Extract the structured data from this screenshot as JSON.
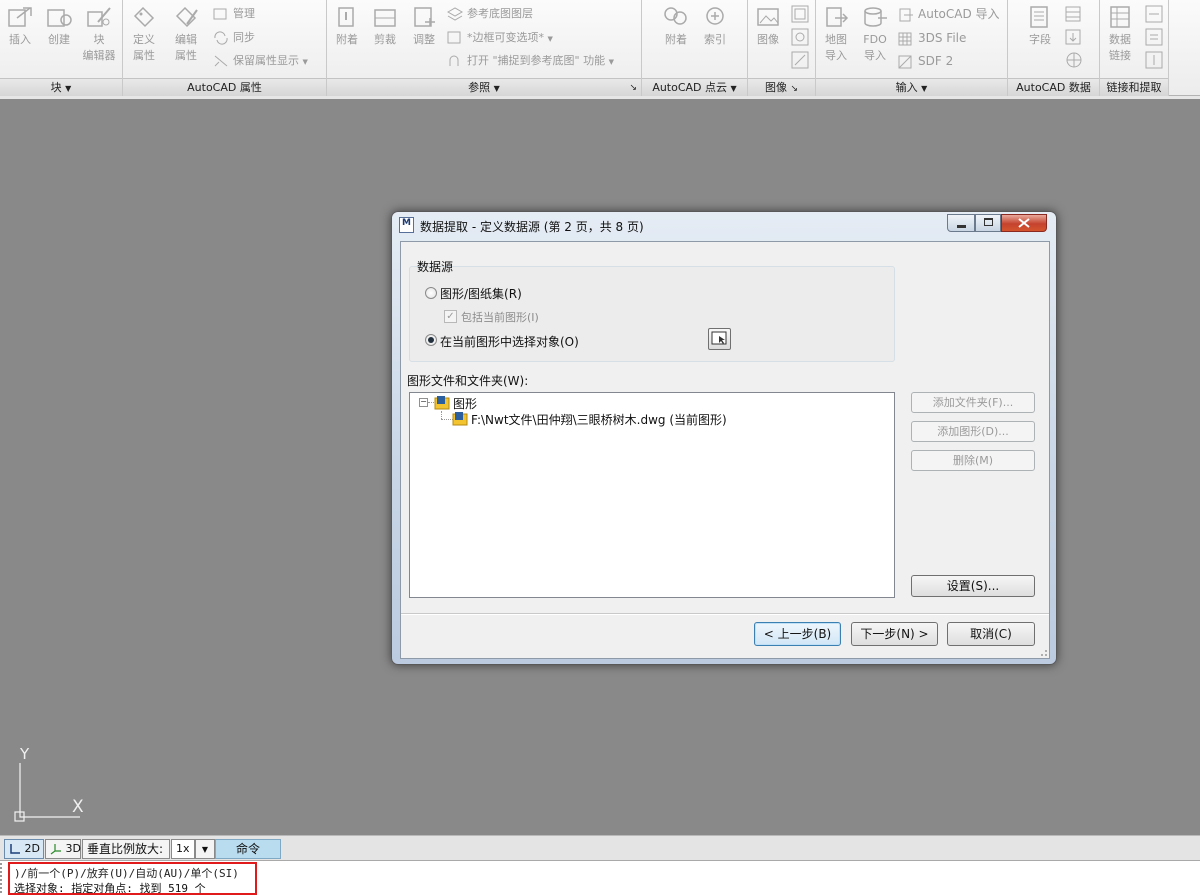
{
  "ribbon": {
    "panels": {
      "block": {
        "title": "块",
        "insert": "插入",
        "create": "创建",
        "block_editor": [
          "块",
          "编辑器"
        ]
      },
      "attributes": {
        "title": "AutoCAD 属性",
        "define_attr": [
          "定义",
          "属性"
        ],
        "edit_attr": [
          "编辑",
          "属性"
        ],
        "manage": "管理",
        "sync": "同步",
        "retain_display": "保留属性显示"
      },
      "reference": {
        "title": "参照",
        "attach": "附着",
        "clip": "剪裁",
        "adjust": "调整",
        "underlay_layers": "参考底图图层",
        "frame_variable": "*边框可变选项*",
        "snap_underlay": "打开 \"捕捉到参考底图\" 功能"
      },
      "pointcloud": {
        "title": "AutoCAD 点云",
        "attach": "附着",
        "index": "索引"
      },
      "image": {
        "title": "图像",
        "image": "图像"
      },
      "import": {
        "title": "输入",
        "map_import": [
          "地图",
          "导入"
        ],
        "fdo_import": [
          "FDO",
          "导入"
        ],
        "autocad_import": "AutoCAD 导入",
        "sds_file": "3DS File",
        "sdf2": "SDF 2"
      },
      "autocad_data": {
        "title": "AutoCAD 数据",
        "field": "字段"
      },
      "link_extract": {
        "title": "链接和提取",
        "data_link": [
          "数据",
          "链接"
        ]
      }
    }
  },
  "dialog": {
    "title": "数据提取 - 定义数据源 (第 2 页，共 8 页)",
    "app_badge": "M",
    "group_title": "数据源",
    "radio_drawings": "图形/图纸集(R)",
    "check_include": "包括当前图形(I)",
    "radio_select": "在当前图形中选择对象(O)",
    "tree_label": "图形文件和文件夹(W):",
    "tree_root": "图形",
    "tree_file": "F:\\Nwt文件\\田仲翔\\三眼桥树木.dwg (当前图形)",
    "btn_add_folder": "添加文件夹(F)...",
    "btn_add_drawing": "添加图形(D)...",
    "btn_remove": "删除(M)",
    "btn_settings": "设置(S)...",
    "btn_back": "< 上一步(B)",
    "btn_next": "下一步(N) >",
    "btn_cancel": "取消(C)"
  },
  "ucs": {
    "x": "X",
    "y": "Y"
  },
  "statusbar": {
    "mode_2d": "2D",
    "mode_3d": "3D",
    "vscale_label": "垂直比例放大:",
    "vscale_value": "1x",
    "command_tab": "命令"
  },
  "commandline": {
    "history": ")/前一个(P)/放弃(U)/自动(AU)/单个(SI)",
    "current": "选择对象: 指定对角点: 找到 519 个"
  },
  "colors": {
    "canvas": "#898989",
    "highlight": "#e01a1a",
    "command_tab": "#b9dcee"
  }
}
